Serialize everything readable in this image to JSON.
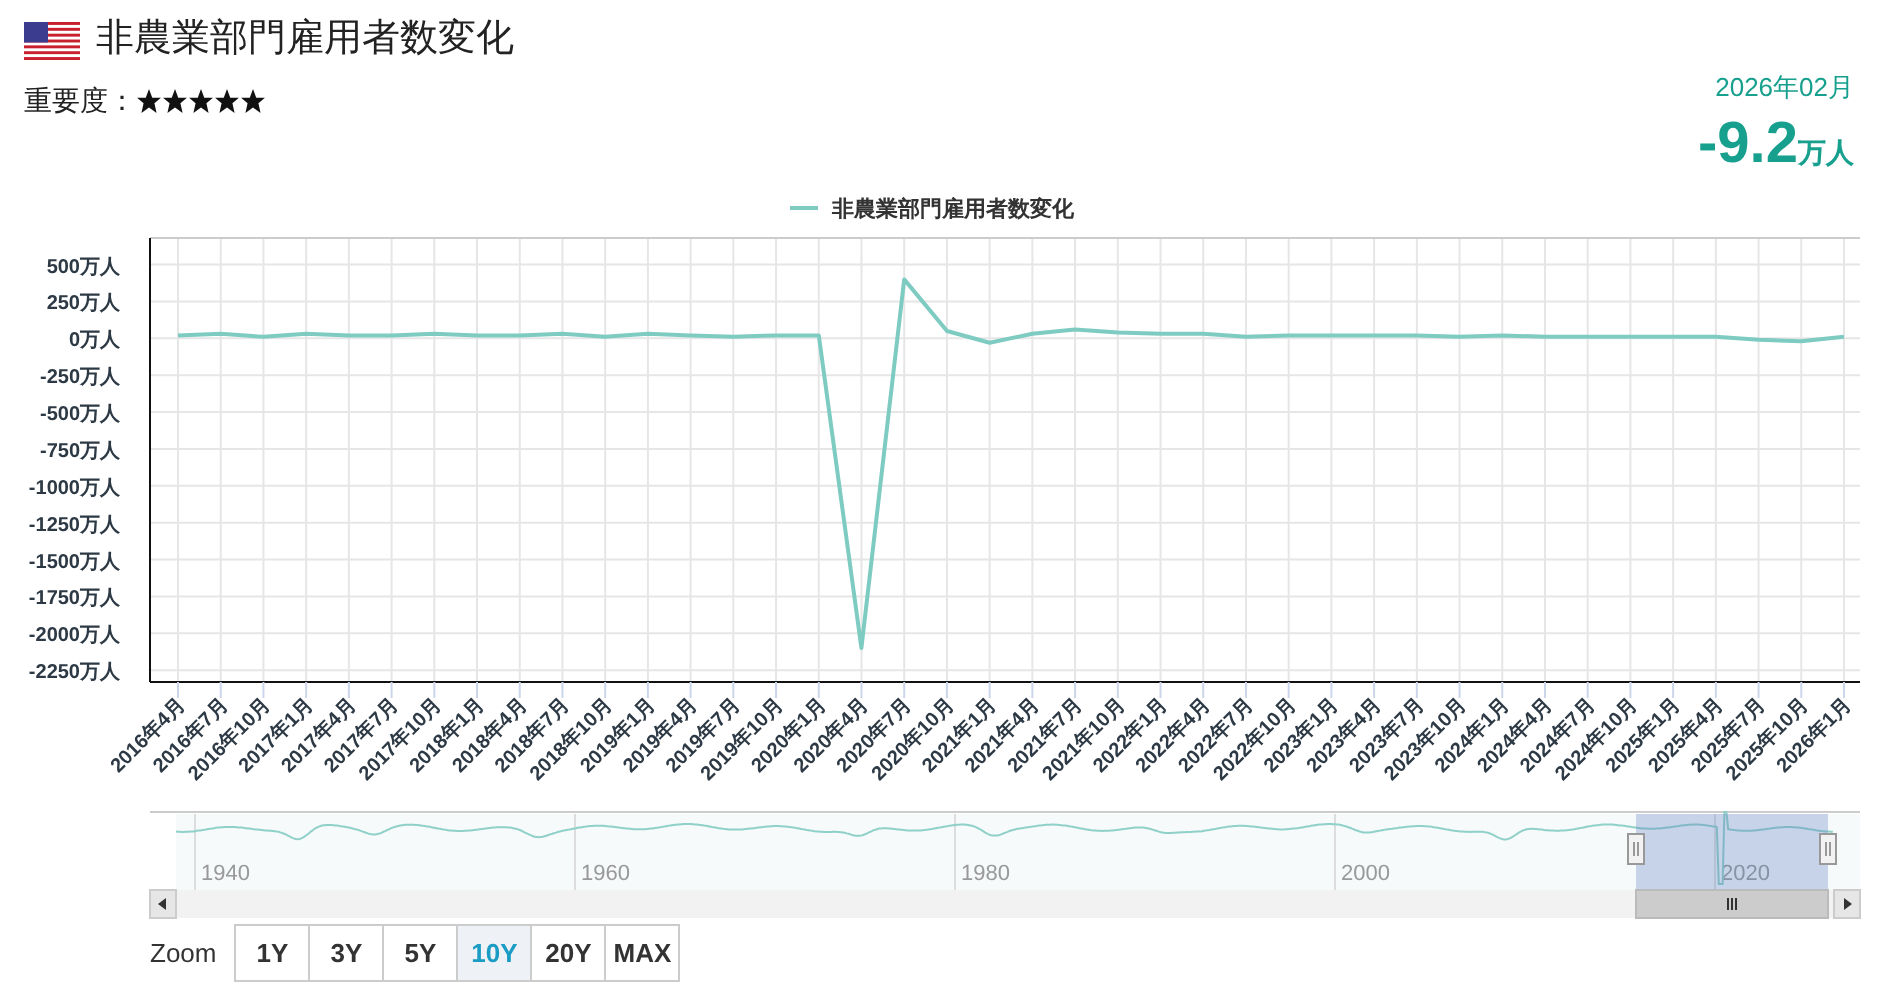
{
  "header": {
    "title": "非農業部門雇用者数変化",
    "importance_label": "重要度：",
    "importance": {
      "stars": 5
    }
  },
  "latest": {
    "period": "2026年02月",
    "value": "-9.2",
    "unit": "万人"
  },
  "chart": {
    "chart_data": {
      "type": "line",
      "grid": true,
      "ylim": [
        -2330,
        680
      ],
      "yticks": [
        {
          "value": 500,
          "label": "500万人"
        },
        {
          "value": 250,
          "label": "250万人"
        },
        {
          "value": 0,
          "label": "0万人"
        },
        {
          "value": -250,
          "label": "-250万人"
        },
        {
          "value": -500,
          "label": "-500万人"
        },
        {
          "value": -750,
          "label": "-750万人"
        },
        {
          "value": -1000,
          "label": "-1000万人"
        },
        {
          "value": -1250,
          "label": "-1250万人"
        },
        {
          "value": -1500,
          "label": "-1500万人"
        },
        {
          "value": -1750,
          "label": "-1750万人"
        },
        {
          "value": -2000,
          "label": "-2000万人"
        },
        {
          "value": -2250,
          "label": "-2250万人"
        }
      ],
      "categories": [
        "2016年4月",
        "2016年7月",
        "2016年10月",
        "2017年1月",
        "2017年4月",
        "2017年7月",
        "2017年10月",
        "2018年1月",
        "2018年4月",
        "2018年7月",
        "2018年10月",
        "2019年1月",
        "2019年4月",
        "2019年7月",
        "2019年10月",
        "2020年1月",
        "2020年4月",
        "2020年7月",
        "2020年10月",
        "2021年1月",
        "2021年4月",
        "2021年7月",
        "2021年10月",
        "2022年1月",
        "2022年4月",
        "2022年7月",
        "2022年10月",
        "2023年1月",
        "2023年4月",
        "2023年7月",
        "2023年10月",
        "2024年1月",
        "2024年4月",
        "2024年7月",
        "2024年10月",
        "2025年1月",
        "2025年4月",
        "2025年7月",
        "2025年10月",
        "2026年1月"
      ],
      "series": [
        {
          "name": "非農業部門雇用者数変化",
          "color": "#7ecbc2",
          "values": [
            20,
            30,
            10,
            30,
            20,
            20,
            30,
            20,
            20,
            30,
            10,
            30,
            20,
            10,
            20,
            20,
            -2100,
            400,
            50,
            -30,
            30,
            60,
            40,
            30,
            30,
            10,
            20,
            20,
            20,
            20,
            10,
            20,
            10,
            10,
            10,
            10,
            10,
            -10,
            -20,
            10
          ]
        }
      ]
    }
  },
  "navigator": {
    "year_labels": [
      "1940",
      "1960",
      "1980",
      "2000",
      "2020"
    ]
  },
  "zoom": {
    "label": "Zoom",
    "buttons": [
      {
        "label": "1Y",
        "selected": false
      },
      {
        "label": "3Y",
        "selected": false
      },
      {
        "label": "5Y",
        "selected": false
      },
      {
        "label": "10Y",
        "selected": true
      },
      {
        "label": "20Y",
        "selected": false
      },
      {
        "label": "MAX",
        "selected": false
      }
    ]
  }
}
